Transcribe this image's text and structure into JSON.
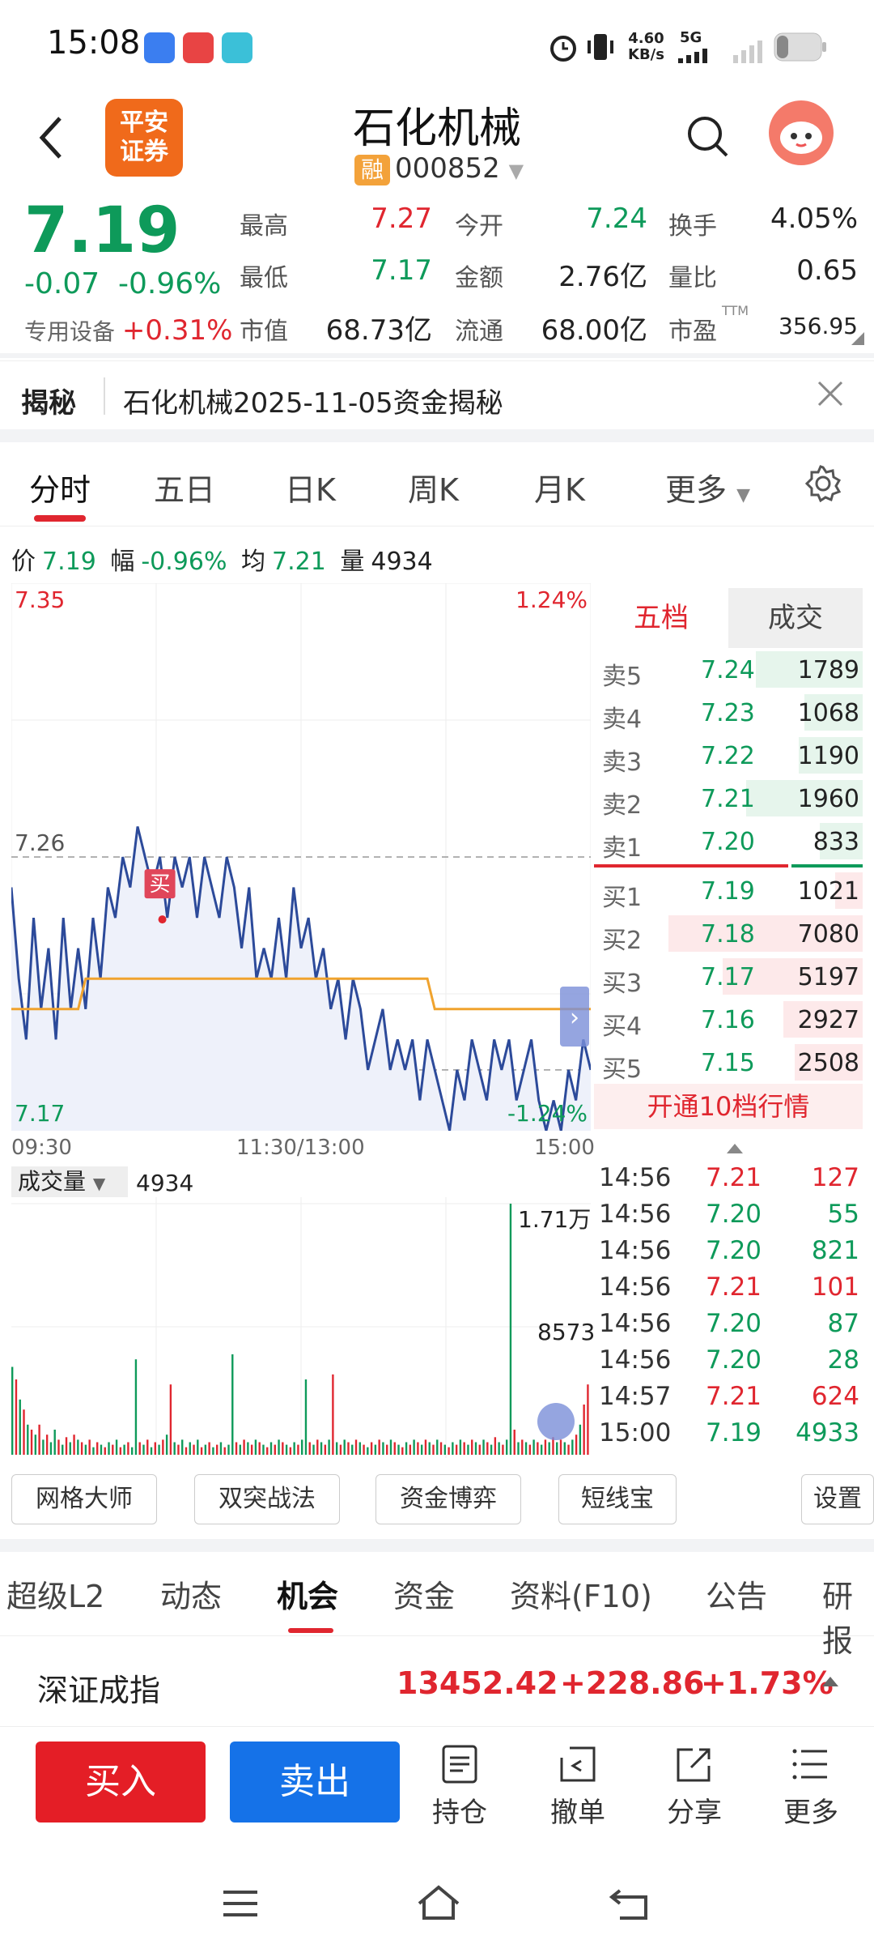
{
  "status": {
    "time": "15:08",
    "net_speed": "4.60\nKB/s",
    "net_speed_line1": "4.60",
    "net_speed_line2": "KB/s",
    "network": "5G"
  },
  "header": {
    "logo_line1": "平安",
    "logo_line2": "证券",
    "title": "石化机械",
    "badge": "融",
    "code": "000852"
  },
  "quote": {
    "price": "7.19",
    "change": "-0.07",
    "change_pct": "-0.96%",
    "sector_name": "专用设备",
    "sector_pct": "+0.31%",
    "fields": [
      {
        "label": "最高",
        "value": "7.27",
        "color": "#e0262f"
      },
      {
        "label": "今开",
        "value": "7.24",
        "color": "#0e9a5a"
      },
      {
        "label": "换手",
        "value": "4.05%",
        "color": "#222"
      },
      {
        "label": "最低",
        "value": "7.17",
        "color": "#0e9a5a"
      },
      {
        "label": "金额",
        "value": "2.76亿",
        "color": "#222"
      },
      {
        "label": "量比",
        "value": "0.65",
        "color": "#222"
      },
      {
        "label": "市值",
        "value": "68.73亿",
        "color": "#222"
      },
      {
        "label": "流通",
        "value": "68.00亿",
        "color": "#222"
      },
      {
        "label": "市盈",
        "value": "356.95",
        "color": "#222"
      }
    ],
    "pe_sup": "TTM"
  },
  "reveal": {
    "label": "揭秘",
    "text": "石化机械2025-11-05资金揭秘"
  },
  "chart_tabs": [
    "分时",
    "五日",
    "日K",
    "周K",
    "月K",
    "更多"
  ],
  "info_row": {
    "price_label": "价",
    "price": "7.19",
    "amp_label": "幅",
    "amp": "-0.96%",
    "avg_label": "均",
    "avg": "7.21",
    "vol_label": "量",
    "vol": "4934"
  },
  "chart_data": {
    "type": "line",
    "y_top_label": "7.35",
    "y_mid_label": "7.26",
    "y_bottom_label": "7.17",
    "pct_top": "1.24%",
    "pct_bottom": "-1.24%",
    "x_labels": [
      "09:30",
      "11:30/13:00",
      "15:00"
    ],
    "ylim": [
      7.17,
      7.35
    ],
    "prev_close": 7.26,
    "buy_marker": "买",
    "price_series": [
      7.25,
      7.22,
      7.2,
      7.24,
      7.21,
      7.23,
      7.2,
      7.24,
      7.21,
      7.23,
      7.21,
      7.24,
      7.22,
      7.25,
      7.24,
      7.26,
      7.25,
      7.27,
      7.26,
      7.25,
      7.26,
      7.24,
      7.26,
      7.25,
      7.26,
      7.24,
      7.26,
      7.25,
      7.24,
      7.26,
      7.25,
      7.23,
      7.25,
      7.22,
      7.23,
      7.22,
      7.24,
      7.22,
      7.25,
      7.23,
      7.24,
      7.22,
      7.23,
      7.21,
      7.22,
      7.2,
      7.22,
      7.21,
      7.19,
      7.2,
      7.21,
      7.19,
      7.2,
      7.19,
      7.2,
      7.18,
      7.2,
      7.19,
      7.18,
      7.17,
      7.19,
      7.18,
      7.2,
      7.19,
      7.18,
      7.2,
      7.19,
      7.2,
      7.18,
      7.19,
      7.2,
      7.18,
      7.17,
      7.18,
      7.17,
      7.19,
      7.18,
      7.2,
      7.19
    ],
    "avg_series": [
      7.21,
      7.21,
      7.21,
      7.21,
      7.21,
      7.21,
      7.21,
      7.21,
      7.21,
      7.21,
      7.22,
      7.22,
      7.22,
      7.22,
      7.22,
      7.22,
      7.22,
      7.22,
      7.22,
      7.22,
      7.22,
      7.22,
      7.22,
      7.22,
      7.22,
      7.22,
      7.22,
      7.22,
      7.22,
      7.22,
      7.22,
      7.22,
      7.22,
      7.22,
      7.22,
      7.22,
      7.22,
      7.22,
      7.22,
      7.22,
      7.22,
      7.22,
      7.22,
      7.22,
      7.22,
      7.22,
      7.22,
      7.22,
      7.22,
      7.22,
      7.22,
      7.22,
      7.22,
      7.22,
      7.22,
      7.22,
      7.22,
      7.21,
      7.21,
      7.21,
      7.21,
      7.21,
      7.21,
      7.21,
      7.21,
      7.21,
      7.21,
      7.21,
      7.21,
      7.21,
      7.21,
      7.21,
      7.21,
      7.21,
      7.21,
      7.21,
      7.21,
      7.21,
      7.21
    ]
  },
  "volume": {
    "label": "成交量",
    "value": "4934",
    "max_label": "1.71万",
    "mid_label": "8573",
    "bars": [
      [
        0.35,
        "g"
      ],
      [
        0.3,
        "r"
      ],
      [
        0.22,
        "g"
      ],
      [
        0.18,
        "r"
      ],
      [
        0.12,
        "g"
      ],
      [
        0.1,
        "r"
      ],
      [
        0.08,
        "g"
      ],
      [
        0.12,
        "r"
      ],
      [
        0.06,
        "g"
      ],
      [
        0.08,
        "r"
      ],
      [
        0.05,
        "g"
      ],
      [
        0.1,
        "g"
      ],
      [
        0.06,
        "r"
      ],
      [
        0.04,
        "g"
      ],
      [
        0.07,
        "r"
      ],
      [
        0.05,
        "g"
      ],
      [
        0.08,
        "r"
      ],
      [
        0.06,
        "g"
      ],
      [
        0.05,
        "r"
      ],
      [
        0.04,
        "g"
      ],
      [
        0.06,
        "r"
      ],
      [
        0.03,
        "g"
      ],
      [
        0.05,
        "r"
      ],
      [
        0.04,
        "g"
      ],
      [
        0.03,
        "r"
      ],
      [
        0.05,
        "g"
      ],
      [
        0.04,
        "r"
      ],
      [
        0.06,
        "g"
      ],
      [
        0.03,
        "r"
      ],
      [
        0.04,
        "g"
      ],
      [
        0.05,
        "r"
      ],
      [
        0.03,
        "g"
      ],
      [
        0.38,
        "g"
      ],
      [
        0.05,
        "r"
      ],
      [
        0.04,
        "g"
      ],
      [
        0.06,
        "r"
      ],
      [
        0.03,
        "g"
      ],
      [
        0.05,
        "r"
      ],
      [
        0.04,
        "g"
      ],
      [
        0.06,
        "r"
      ],
      [
        0.08,
        "g"
      ],
      [
        0.28,
        "r"
      ],
      [
        0.05,
        "g"
      ],
      [
        0.04,
        "r"
      ],
      [
        0.06,
        "g"
      ],
      [
        0.03,
        "r"
      ],
      [
        0.05,
        "g"
      ],
      [
        0.04,
        "r"
      ],
      [
        0.06,
        "g"
      ],
      [
        0.03,
        "r"
      ],
      [
        0.04,
        "g"
      ],
      [
        0.05,
        "r"
      ],
      [
        0.03,
        "g"
      ],
      [
        0.04,
        "r"
      ],
      [
        0.05,
        "g"
      ],
      [
        0.03,
        "r"
      ],
      [
        0.04,
        "g"
      ],
      [
        0.4,
        "g"
      ],
      [
        0.05,
        "r"
      ],
      [
        0.04,
        "g"
      ],
      [
        0.06,
        "r"
      ],
      [
        0.05,
        "g"
      ],
      [
        0.04,
        "r"
      ],
      [
        0.06,
        "g"
      ],
      [
        0.05,
        "r"
      ],
      [
        0.04,
        "g"
      ],
      [
        0.03,
        "r"
      ],
      [
        0.05,
        "g"
      ],
      [
        0.04,
        "r"
      ],
      [
        0.06,
        "g"
      ],
      [
        0.05,
        "r"
      ],
      [
        0.04,
        "g"
      ],
      [
        0.03,
        "r"
      ],
      [
        0.05,
        "g"
      ],
      [
        0.04,
        "r"
      ],
      [
        0.06,
        "g"
      ],
      [
        0.3,
        "g"
      ],
      [
        0.05,
        "r"
      ],
      [
        0.04,
        "g"
      ],
      [
        0.06,
        "r"
      ],
      [
        0.05,
        "g"
      ],
      [
        0.04,
        "r"
      ],
      [
        0.06,
        "g"
      ],
      [
        0.32,
        "r"
      ],
      [
        0.05,
        "g"
      ],
      [
        0.04,
        "r"
      ],
      [
        0.06,
        "g"
      ],
      [
        0.05,
        "r"
      ],
      [
        0.04,
        "g"
      ],
      [
        0.06,
        "r"
      ],
      [
        0.05,
        "g"
      ],
      [
        0.04,
        "r"
      ],
      [
        0.03,
        "g"
      ],
      [
        0.05,
        "r"
      ],
      [
        0.04,
        "g"
      ],
      [
        0.06,
        "r"
      ],
      [
        0.05,
        "g"
      ],
      [
        0.04,
        "r"
      ],
      [
        0.06,
        "g"
      ],
      [
        0.05,
        "r"
      ],
      [
        0.04,
        "g"
      ],
      [
        0.03,
        "r"
      ],
      [
        0.05,
        "g"
      ],
      [
        0.04,
        "r"
      ],
      [
        0.06,
        "g"
      ],
      [
        0.05,
        "r"
      ],
      [
        0.04,
        "g"
      ],
      [
        0.06,
        "r"
      ],
      [
        0.05,
        "g"
      ],
      [
        0.04,
        "r"
      ],
      [
        0.06,
        "g"
      ],
      [
        0.05,
        "r"
      ],
      [
        0.04,
        "g"
      ],
      [
        0.03,
        "r"
      ],
      [
        0.05,
        "g"
      ],
      [
        0.04,
        "r"
      ],
      [
        0.06,
        "g"
      ],
      [
        0.05,
        "r"
      ],
      [
        0.04,
        "g"
      ],
      [
        0.06,
        "r"
      ],
      [
        0.05,
        "g"
      ],
      [
        0.04,
        "r"
      ],
      [
        0.06,
        "g"
      ],
      [
        0.05,
        "r"
      ],
      [
        0.04,
        "g"
      ],
      [
        0.07,
        "r"
      ],
      [
        0.05,
        "g"
      ],
      [
        0.04,
        "r"
      ],
      [
        0.06,
        "g"
      ],
      [
        1.0,
        "g"
      ],
      [
        0.1,
        "r"
      ],
      [
        0.05,
        "g"
      ],
      [
        0.06,
        "r"
      ],
      [
        0.05,
        "g"
      ],
      [
        0.04,
        "r"
      ],
      [
        0.06,
        "g"
      ],
      [
        0.05,
        "r"
      ],
      [
        0.04,
        "g"
      ],
      [
        0.06,
        "r"
      ],
      [
        0.05,
        "g"
      ],
      [
        0.07,
        "r"
      ],
      [
        0.05,
        "g"
      ],
      [
        0.06,
        "r"
      ],
      [
        0.05,
        "g"
      ],
      [
        0.04,
        "r"
      ],
      [
        0.06,
        "g"
      ],
      [
        0.08,
        "r"
      ],
      [
        0.12,
        "g"
      ],
      [
        0.2,
        "r"
      ],
      [
        0.28,
        "r"
      ]
    ]
  },
  "book": {
    "tabs": [
      "五档",
      "成交"
    ],
    "asks": [
      {
        "label": "卖5",
        "price": "7.24",
        "vol": "1789",
        "bar": 0.55
      },
      {
        "label": "卖4",
        "price": "7.23",
        "vol": "1068",
        "bar": 0.3
      },
      {
        "label": "卖3",
        "price": "7.22",
        "vol": "1190",
        "bar": 0.33
      },
      {
        "label": "卖2",
        "price": "7.21",
        "vol": "1960",
        "bar": 0.6
      },
      {
        "label": "卖1",
        "price": "7.20",
        "vol": "833",
        "bar": 0.22
      }
    ],
    "bids": [
      {
        "label": "买1",
        "price": "7.19",
        "vol": "1021",
        "bar": 0.14
      },
      {
        "label": "买2",
        "price": "7.18",
        "vol": "7080",
        "bar": 1.0
      },
      {
        "label": "买3",
        "price": "7.17",
        "vol": "5197",
        "bar": 0.72
      },
      {
        "label": "买4",
        "price": "7.16",
        "vol": "2927",
        "bar": 0.41
      },
      {
        "label": "买5",
        "price": "7.15",
        "vol": "2508",
        "bar": 0.35
      }
    ],
    "open_10": "开通10档行情"
  },
  "ticks": [
    {
      "time": "14:56",
      "price": "7.21",
      "vol": "127",
      "color": "#e0262f"
    },
    {
      "time": "14:56",
      "price": "7.20",
      "vol": "55",
      "color": "#0e9a5a"
    },
    {
      "time": "14:56",
      "price": "7.20",
      "vol": "821",
      "color": "#0e9a5a"
    },
    {
      "time": "14:56",
      "price": "7.21",
      "vol": "101",
      "color": "#e0262f"
    },
    {
      "time": "14:56",
      "price": "7.20",
      "vol": "87",
      "color": "#0e9a5a"
    },
    {
      "time": "14:56",
      "price": "7.20",
      "vol": "28",
      "color": "#0e9a5a"
    },
    {
      "time": "14:57",
      "price": "7.21",
      "vol": "624",
      "color": "#e0262f"
    },
    {
      "time": "15:00",
      "price": "7.19",
      "vol": "4933",
      "color": "#0e9a5a"
    }
  ],
  "tools": [
    "网格大师",
    "双突战法",
    "资金博弈",
    "短线宝",
    "设置"
  ],
  "bottom_tabs": [
    "超级L2",
    "动态",
    "机会",
    "资金",
    "资料(F10)",
    "公告",
    "研报"
  ],
  "index": {
    "name": "深证成指",
    "value": "13452.42",
    "change": "+228.86",
    "pct": "+1.73%"
  },
  "actions": {
    "buy": "买入",
    "sell": "卖出",
    "hold": "持仓",
    "cancel": "撤单",
    "share": "分享",
    "more": "更多"
  }
}
